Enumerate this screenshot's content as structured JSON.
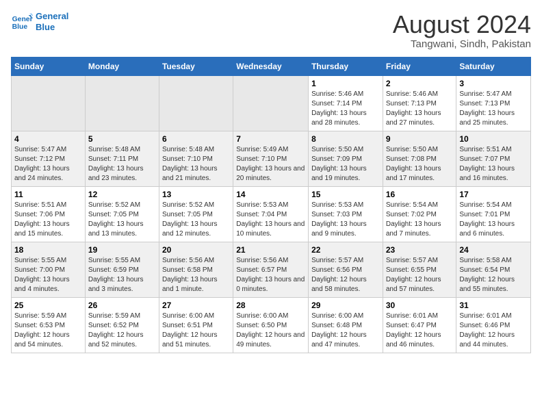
{
  "header": {
    "logo_line1": "General",
    "logo_line2": "Blue",
    "main_title": "August 2024",
    "subtitle": "Tangwani, Sindh, Pakistan"
  },
  "days_of_week": [
    "Sunday",
    "Monday",
    "Tuesday",
    "Wednesday",
    "Thursday",
    "Friday",
    "Saturday"
  ],
  "weeks": [
    [
      {
        "num": "",
        "content": ""
      },
      {
        "num": "",
        "content": ""
      },
      {
        "num": "",
        "content": ""
      },
      {
        "num": "",
        "content": ""
      },
      {
        "num": "1",
        "content": "Sunrise: 5:46 AM\nSunset: 7:14 PM\nDaylight: 13 hours and 28 minutes."
      },
      {
        "num": "2",
        "content": "Sunrise: 5:46 AM\nSunset: 7:13 PM\nDaylight: 13 hours and 27 minutes."
      },
      {
        "num": "3",
        "content": "Sunrise: 5:47 AM\nSunset: 7:13 PM\nDaylight: 13 hours and 25 minutes."
      }
    ],
    [
      {
        "num": "4",
        "content": "Sunrise: 5:47 AM\nSunset: 7:12 PM\nDaylight: 13 hours and 24 minutes."
      },
      {
        "num": "5",
        "content": "Sunrise: 5:48 AM\nSunset: 7:11 PM\nDaylight: 13 hours and 23 minutes."
      },
      {
        "num": "6",
        "content": "Sunrise: 5:48 AM\nSunset: 7:10 PM\nDaylight: 13 hours and 21 minutes."
      },
      {
        "num": "7",
        "content": "Sunrise: 5:49 AM\nSunset: 7:10 PM\nDaylight: 13 hours and 20 minutes."
      },
      {
        "num": "8",
        "content": "Sunrise: 5:50 AM\nSunset: 7:09 PM\nDaylight: 13 hours and 19 minutes."
      },
      {
        "num": "9",
        "content": "Sunrise: 5:50 AM\nSunset: 7:08 PM\nDaylight: 13 hours and 17 minutes."
      },
      {
        "num": "10",
        "content": "Sunrise: 5:51 AM\nSunset: 7:07 PM\nDaylight: 13 hours and 16 minutes."
      }
    ],
    [
      {
        "num": "11",
        "content": "Sunrise: 5:51 AM\nSunset: 7:06 PM\nDaylight: 13 hours and 15 minutes."
      },
      {
        "num": "12",
        "content": "Sunrise: 5:52 AM\nSunset: 7:05 PM\nDaylight: 13 hours and 13 minutes."
      },
      {
        "num": "13",
        "content": "Sunrise: 5:52 AM\nSunset: 7:05 PM\nDaylight: 13 hours and 12 minutes."
      },
      {
        "num": "14",
        "content": "Sunrise: 5:53 AM\nSunset: 7:04 PM\nDaylight: 13 hours and 10 minutes."
      },
      {
        "num": "15",
        "content": "Sunrise: 5:53 AM\nSunset: 7:03 PM\nDaylight: 13 hours and 9 minutes."
      },
      {
        "num": "16",
        "content": "Sunrise: 5:54 AM\nSunset: 7:02 PM\nDaylight: 13 hours and 7 minutes."
      },
      {
        "num": "17",
        "content": "Sunrise: 5:54 AM\nSunset: 7:01 PM\nDaylight: 13 hours and 6 minutes."
      }
    ],
    [
      {
        "num": "18",
        "content": "Sunrise: 5:55 AM\nSunset: 7:00 PM\nDaylight: 13 hours and 4 minutes."
      },
      {
        "num": "19",
        "content": "Sunrise: 5:55 AM\nSunset: 6:59 PM\nDaylight: 13 hours and 3 minutes."
      },
      {
        "num": "20",
        "content": "Sunrise: 5:56 AM\nSunset: 6:58 PM\nDaylight: 13 hours and 1 minute."
      },
      {
        "num": "21",
        "content": "Sunrise: 5:56 AM\nSunset: 6:57 PM\nDaylight: 13 hours and 0 minutes."
      },
      {
        "num": "22",
        "content": "Sunrise: 5:57 AM\nSunset: 6:56 PM\nDaylight: 12 hours and 58 minutes."
      },
      {
        "num": "23",
        "content": "Sunrise: 5:57 AM\nSunset: 6:55 PM\nDaylight: 12 hours and 57 minutes."
      },
      {
        "num": "24",
        "content": "Sunrise: 5:58 AM\nSunset: 6:54 PM\nDaylight: 12 hours and 55 minutes."
      }
    ],
    [
      {
        "num": "25",
        "content": "Sunrise: 5:59 AM\nSunset: 6:53 PM\nDaylight: 12 hours and 54 minutes."
      },
      {
        "num": "26",
        "content": "Sunrise: 5:59 AM\nSunset: 6:52 PM\nDaylight: 12 hours and 52 minutes."
      },
      {
        "num": "27",
        "content": "Sunrise: 6:00 AM\nSunset: 6:51 PM\nDaylight: 12 hours and 51 minutes."
      },
      {
        "num": "28",
        "content": "Sunrise: 6:00 AM\nSunset: 6:50 PM\nDaylight: 12 hours and 49 minutes."
      },
      {
        "num": "29",
        "content": "Sunrise: 6:00 AM\nSunset: 6:48 PM\nDaylight: 12 hours and 47 minutes."
      },
      {
        "num": "30",
        "content": "Sunrise: 6:01 AM\nSunset: 6:47 PM\nDaylight: 12 hours and 46 minutes."
      },
      {
        "num": "31",
        "content": "Sunrise: 6:01 AM\nSunset: 6:46 PM\nDaylight: 12 hours and 44 minutes."
      }
    ]
  ]
}
